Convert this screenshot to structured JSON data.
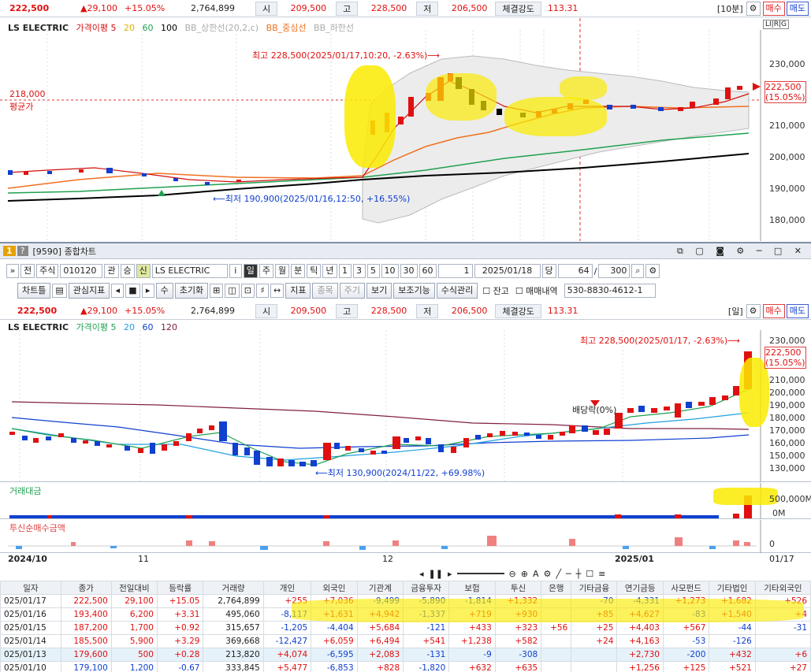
{
  "top_quote": {
    "price": "222,500",
    "change": "▲29,100",
    "pct": "+15.05%",
    "volume": "2,764,899",
    "open_lbl": "시",
    "open": "209,500",
    "high_lbl": "고",
    "high": "228,500",
    "low_lbl": "저",
    "low": "206,500",
    "strength_lbl": "체결강도",
    "strength": "113.31",
    "period": "[10분]",
    "buy": "매수",
    "sell": "매도"
  },
  "top_chart": {
    "legend": {
      "name": "LS ELECTRIC",
      "ma": "가격이평 5",
      "ma20": "20",
      "ma60": "60",
      "ma100": "100",
      "bb_upper": "BB_상한선(20,2,c)",
      "bb_mid": "BB_중심선",
      "bb_lower": "BB_하한선"
    },
    "high_note": "최고 228,500(2025/01/17,10:20, -2.63%)⟶",
    "low_note": "⟵최저 190,900(2025/01/16,12:50, +16.55%)",
    "avg_price": "218,000",
    "avg_lbl": "평균가",
    "cur_tag": "222,500",
    "cur_pct": "(15.05%)",
    "axis": [
      "230,000",
      "220,000",
      "210,000",
      "200,000",
      "190,000",
      "180,000"
    ],
    "tools": "LI|R|G"
  },
  "window": {
    "num": "1",
    "help": "?",
    "title": "[9590] 종합차트",
    "icons": "⧉ ▢ ◙ ⚙ ─ □ ✕"
  },
  "toolbar1": {
    "back": "»",
    "prev": "전",
    "type": "주식",
    "code": "010120",
    "rel": "관",
    "up": "승",
    "sin": "신",
    "name": "LS ELECTRIC",
    "info": "i",
    "periods": [
      "일",
      "주",
      "월",
      "분",
      "틱",
      "년"
    ],
    "minutes": [
      "1",
      "3",
      "5",
      "10",
      "30",
      "60"
    ],
    "sel_min": "1",
    "date": "2025/01/18",
    "dang": "당",
    "count": "64",
    "slash": "/",
    "total": "300"
  },
  "toolbar2": {
    "chart_type": "차트틀",
    "indicator": "관심지표",
    "mod": "수",
    "reset": "초기화",
    "show_table": "지표",
    "show_item": "종목",
    "cycle": "주기",
    "view": "보기",
    "assist": "보조기능",
    "formula": "수식관리",
    "balance": "잔고",
    "trade": "매매내역",
    "account": "530-8830-4612-1"
  },
  "mid_quote": {
    "price": "222,500",
    "change": "▲29,100",
    "pct": "+15.05%",
    "volume": "2,764,899",
    "open_lbl": "시",
    "open": "209,500",
    "high_lbl": "고",
    "high": "228,500",
    "low_lbl": "저",
    "low": "206,500",
    "strength_lbl": "체결강도",
    "strength": "113.31",
    "period": "[일]",
    "buy": "매수",
    "sell": "매도"
  },
  "main_chart": {
    "legend": {
      "name": "LS ELECTRIC",
      "ma": "가격이평 5",
      "ma20": "20",
      "ma60": "60",
      "ma120": "120"
    },
    "high_note": "최고 228,500(2025/01/17, -2.63%)⟶",
    "low_note": "⟵최저 130,900(2024/11/22, +69.98%)",
    "div_note": "배당락(0%)",
    "cur_tag": "222,500",
    "cur_pct": "(15.05%)",
    "axis": [
      "230,000",
      "220,000",
      "210,000",
      "200,000",
      "190,000",
      "180,000",
      "170,000",
      "160,000",
      "150,000",
      "140,000",
      "130,000"
    ]
  },
  "volume_panel": {
    "title": "거래대금",
    "axis_top": "500,000M",
    "axis_bot": "0M"
  },
  "inv_panel": {
    "title": "투신순매수금액",
    "axis": "0"
  },
  "xaxis": {
    "labels": [
      "2024/10",
      "11",
      "12",
      "2025/01",
      "01/17"
    ]
  },
  "table": {
    "headers": [
      "일자",
      "종가",
      "전일대비",
      "등락률",
      "거래량",
      "개인",
      "외국인",
      "기관계",
      "금융투자",
      "보험",
      "투신",
      "은행",
      "기타금융",
      "연기금등",
      "사모펀드",
      "기타법인",
      "기타외국인"
    ],
    "rows": [
      [
        "025/01/17",
        "222,500",
        "29,100",
        "+15.05",
        "2,764,899",
        "+255",
        "+7,036",
        "-9,499",
        "-5,890",
        "-1,814",
        "+1,332",
        "",
        "-70",
        "-4,331",
        "+1,273",
        "+1,682",
        "+526"
      ],
      [
        "025/01/16",
        "193,400",
        "6,200",
        "+3.31",
        "495,060",
        "-8,117",
        "+1,631",
        "+4,942",
        "-1,337",
        "+719",
        "+930",
        "",
        "+85",
        "+4,627",
        "-83",
        "+1,540",
        "+4"
      ],
      [
        "025/01/15",
        "187,200",
        "1,700",
        "+0.92",
        "315,657",
        "-1,205",
        "-4,404",
        "+5,684",
        "-121",
        "+433",
        "+323",
        "+56",
        "+25",
        "+4,403",
        "+567",
        "-44",
        "-31"
      ],
      [
        "025/01/14",
        "185,500",
        "5,900",
        "+3.29",
        "369,668",
        "-12,427",
        "+6,059",
        "+6,494",
        "+541",
        "+1,238",
        "+582",
        "",
        "+24",
        "+4,163",
        "-53",
        "-126",
        ""
      ],
      [
        "025/01/13",
        "179,600",
        "500",
        "+0.28",
        "213,820",
        "+4,074",
        "-6,595",
        "+2,083",
        "-131",
        "-9",
        "-308",
        "",
        "",
        "+2,730",
        "-200",
        "+432",
        "+6"
      ],
      [
        "025/01/10",
        "179,100",
        "1,200",
        "-0.67",
        "333,845",
        "+5,477",
        "-6,853",
        "+828",
        "-1,820",
        "+632",
        "+635",
        "",
        "",
        "+1,256",
        "+125",
        "+521",
        "+27"
      ]
    ]
  },
  "colors": {
    "up": "#e01010",
    "down": "#1040d0",
    "highlight": "#f5e400"
  }
}
